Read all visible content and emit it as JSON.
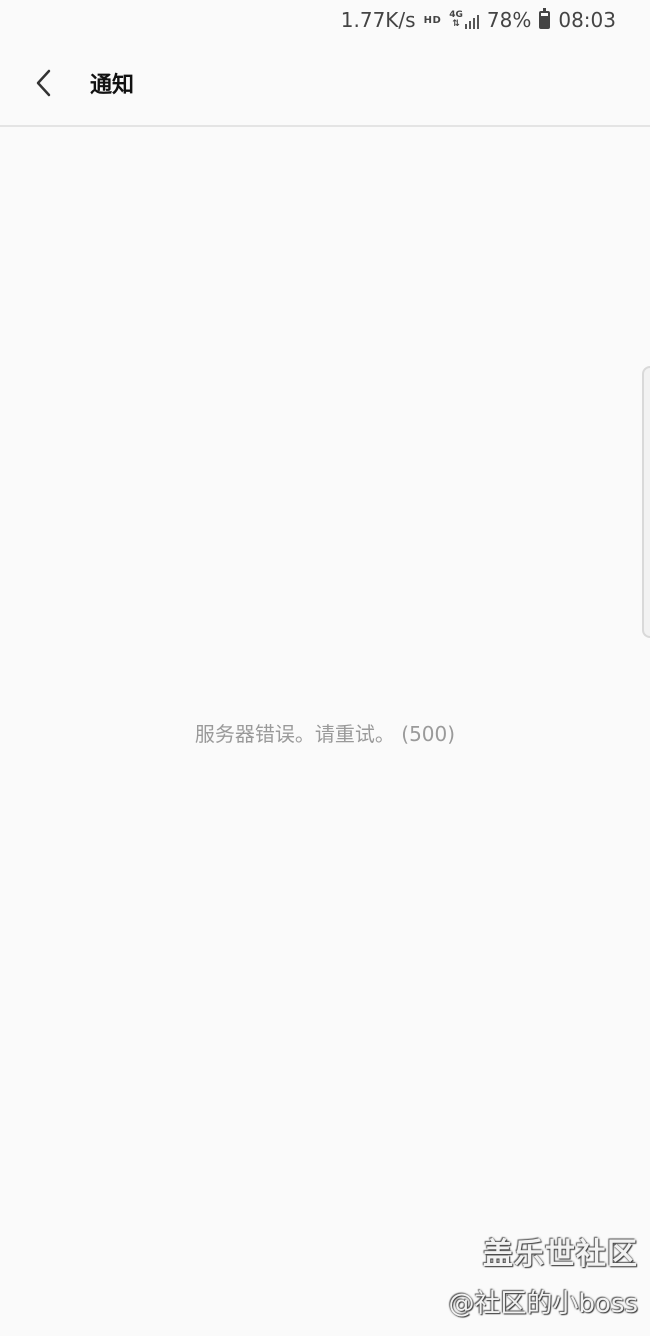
{
  "status_bar": {
    "net_speed": "1.77K/s",
    "hd_label": "HD",
    "network_type": "4G",
    "battery": "78%",
    "time": "08:03"
  },
  "app_bar": {
    "title": "通知"
  },
  "content": {
    "error_message": "服务器错误。请重试。 (500)"
  },
  "watermark": {
    "brand": "盖乐世社区",
    "user": "@社区的小boss"
  },
  "icons": {
    "back": "chevron-left-icon",
    "signal": "signal-icon",
    "battery": "battery-icon"
  }
}
